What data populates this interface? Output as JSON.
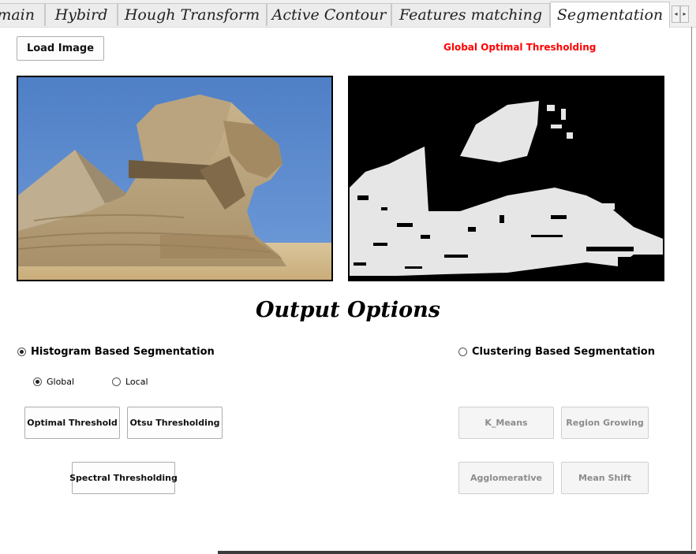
{
  "tabs": [
    {
      "label": "main",
      "active": false
    },
    {
      "label": "Hybird",
      "active": false
    },
    {
      "label": "Hough Transform",
      "active": false
    },
    {
      "label": "Active Contour",
      "active": false
    },
    {
      "label": "Features matching",
      "active": false
    },
    {
      "label": "Segmentation",
      "active": true
    }
  ],
  "tab_scroll": {
    "left_icon": "◂",
    "right_icon": "▸"
  },
  "load_button": "Load Image",
  "method_label": "Global Optimal Thresholding",
  "method_label_color": "#ff0000",
  "images": {
    "input_icon": "sphinx-photo",
    "output_icon": "thresholded-binary-image"
  },
  "output_title": "Output Options",
  "histogram": {
    "label": "Histogram Based Segmentation",
    "checked": true,
    "scope": {
      "global_label": "Global",
      "local_label": "Local",
      "selected": "Global"
    },
    "buttons": {
      "optimal": "Optimal Threshold",
      "otsu": "Otsu Thresholding",
      "spectral": "Spectral Thresholding"
    }
  },
  "clustering": {
    "label": "Clustering Based Segmentation",
    "checked": false,
    "buttons": {
      "kmeans": "K_Means",
      "region_growing": "Region Growing",
      "agglomerative": "Agglomerative",
      "mean_shift": "Mean Shift"
    },
    "enabled": false
  }
}
